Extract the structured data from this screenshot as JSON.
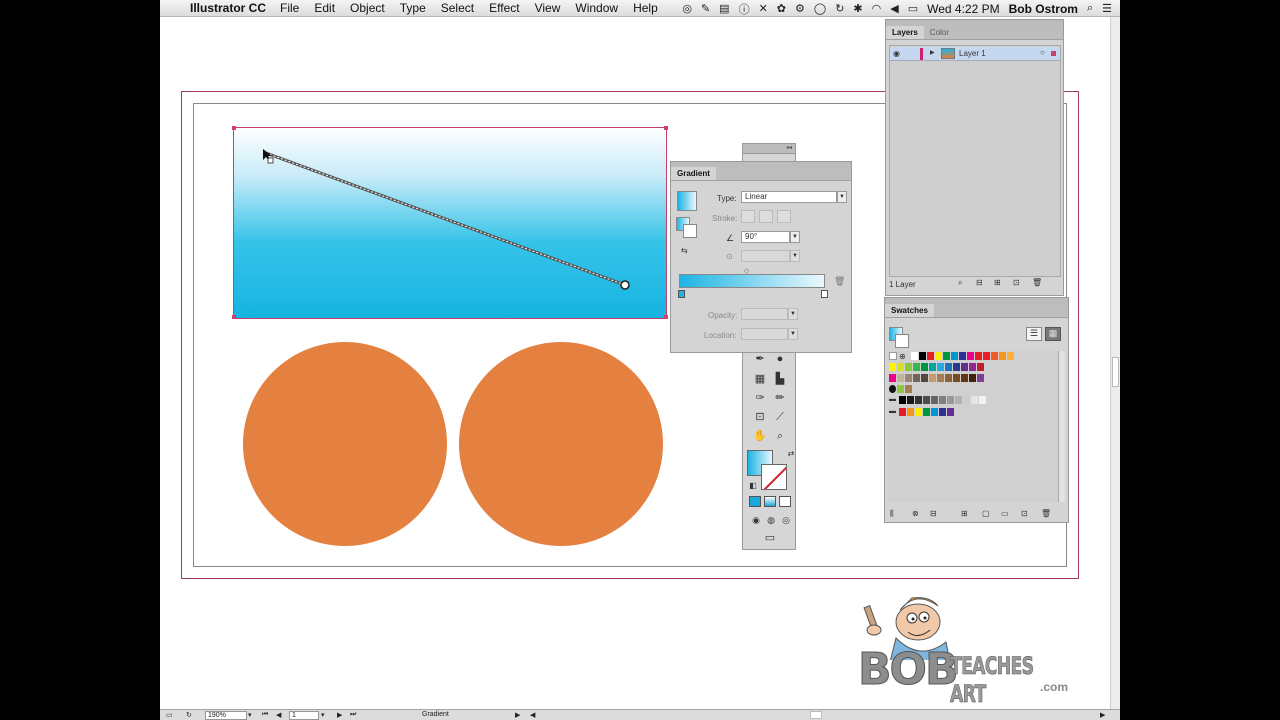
{
  "menubar": {
    "app_name": "Illustrator CC",
    "menus": [
      "File",
      "Edit",
      "Object",
      "Type",
      "Select",
      "Effect",
      "View",
      "Window",
      "Help"
    ],
    "clock": "Wed 4:22 PM",
    "user": "Bob Ostrom"
  },
  "gradient_panel": {
    "title": "Gradient",
    "type_label": "Type:",
    "type_value": "Linear",
    "stroke_label": "Stroke:",
    "angle_value": "90°",
    "opacity_label": "Opacity:",
    "location_label": "Location:"
  },
  "layers_panel": {
    "tabs": [
      "Layers",
      "Color"
    ],
    "layer_name": "Layer 1",
    "count_label": "1 Layer"
  },
  "swatches_panel": {
    "title": "Swatches",
    "row1": [
      "#ffffff",
      "#000000",
      "#e31e24",
      "#ffed00",
      "#00963f",
      "#0096d6",
      "#2e3192",
      "#ec008c",
      "#e31e24",
      "#ed1c24",
      "#f15a24",
      "#f7941d",
      "#fbb040"
    ],
    "row2": [
      "#fff200",
      "#d7df23",
      "#8dc63f",
      "#39b54a",
      "#009444",
      "#00a79d",
      "#27aae1",
      "#1c75bc",
      "#2b3990",
      "#662d91",
      "#92278f",
      "#be1e2d"
    ],
    "row3": [
      "#ec008c",
      "#c1b49a",
      "#998675",
      "#736357",
      "#534741",
      "#c69c6d",
      "#a67c52",
      "#8c6239",
      "#754c24",
      "#603813",
      "#42210b",
      "#7f3f98"
    ],
    "row5": [
      "#000000",
      "#1a1a1a",
      "#333333",
      "#4d4d4d",
      "#666666",
      "#808080",
      "#999999",
      "#b3b3b3",
      "#cccccc",
      "#e6e6e6",
      "#f2f2f2"
    ],
    "row6": [
      "#e31e24",
      "#f7941d",
      "#ffed00",
      "#00963f",
      "#0096d6",
      "#2e3192",
      "#662d91"
    ]
  },
  "statusbar": {
    "zoom": "190%",
    "artboard_num": "1",
    "tool_name": "Gradient"
  },
  "logo": {
    "big": "BOB",
    "small": "TEACHES ART",
    "com": ".com"
  },
  "colors": {
    "circle_fill": "#e48040",
    "gradient_start": "#ffffff",
    "gradient_end": "#17b3e1",
    "selection": "#c6416b"
  }
}
